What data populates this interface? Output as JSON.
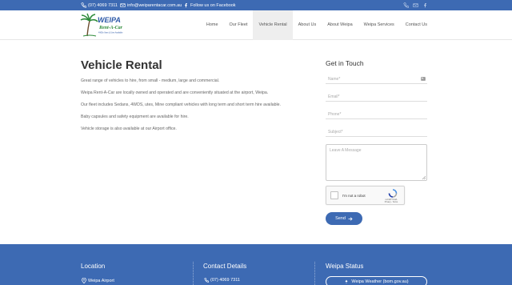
{
  "topbar": {
    "phone": "(07) 4069 7311",
    "email": "info@weiparentacar.com.au",
    "facebook": "Follow us on Facebook"
  },
  "logo": {
    "brand": "WEIPA",
    "sub": "Rent-A-Car",
    "tagline": "4WDs Vans & Utes Available"
  },
  "nav": [
    "Home",
    "Our Fleet",
    "Vehicle Rental",
    "About Us",
    "About Weipa",
    "Weipa Services",
    "Contact Us"
  ],
  "main": {
    "title": "Vehicle Rental",
    "paragraphs": [
      "Great range of vehicles to hire, from small - medium, large and commercial.",
      "Weipa Rent-A-Car are locally owned and operated and are conveniently situated at the airport, Weipa.",
      "Our fleet includes Sedans, 4WDS, utes, Mine compliant vehicles with long term and short term hire available.",
      "Baby capsules and safety equipment are available for hire.",
      "Vehicle storage is also available at our Airport office."
    ]
  },
  "contact_form": {
    "heading": "Get in Touch",
    "name_placeholder": "Name*",
    "email_placeholder": "Email*",
    "phone_placeholder": "Phone*",
    "subject_placeholder": "Subject*",
    "message_placeholder": "Leave A Message",
    "recaptcha_label": "I'm not a robot",
    "recaptcha_brand": "reCAPTCHA",
    "recaptcha_links": "Privacy - Terms",
    "send_label": "Send"
  },
  "footer": {
    "location_heading": "Location",
    "location_item": "Weipa Airport",
    "contact_heading": "Contact Details",
    "contact_item": "(07) 4069 7311",
    "status_heading": "Weipa Status",
    "status_button": "Weipa Weather (bom.gov.au)"
  },
  "colors": {
    "brand_blue": "#3d6ab3",
    "logo_green": "#2e8b3a"
  }
}
